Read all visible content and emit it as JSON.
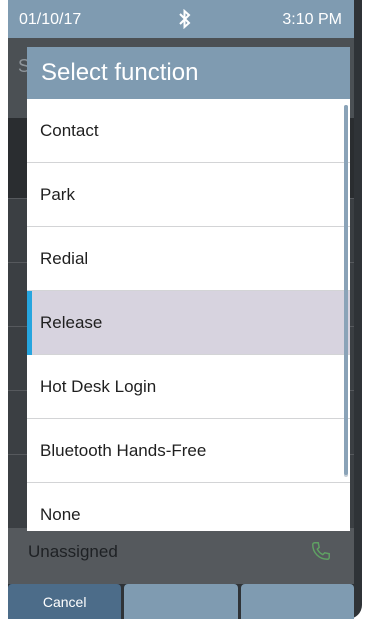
{
  "status_bar": {
    "date": "01/10/17",
    "time": "3:10 PM"
  },
  "background": {
    "line_key_label": "Unassigned"
  },
  "dialog": {
    "title": "Select function",
    "items": [
      {
        "label": "Contact",
        "selected": false
      },
      {
        "label": "Park",
        "selected": false
      },
      {
        "label": "Redial",
        "selected": false
      },
      {
        "label": "Release",
        "selected": true
      },
      {
        "label": "Hot Desk Login",
        "selected": false
      },
      {
        "label": "Bluetooth Hands-Free",
        "selected": false
      },
      {
        "label": "None",
        "selected": false
      }
    ]
  },
  "softkeys": [
    {
      "label": "Cancel"
    },
    {
      "label": ""
    },
    {
      "label": ""
    }
  ],
  "colors": {
    "header": "#7f9bb1",
    "selected_row": "#d7d3df",
    "selected_accent": "#26a5df",
    "cancel_key": "#4c6c89"
  }
}
